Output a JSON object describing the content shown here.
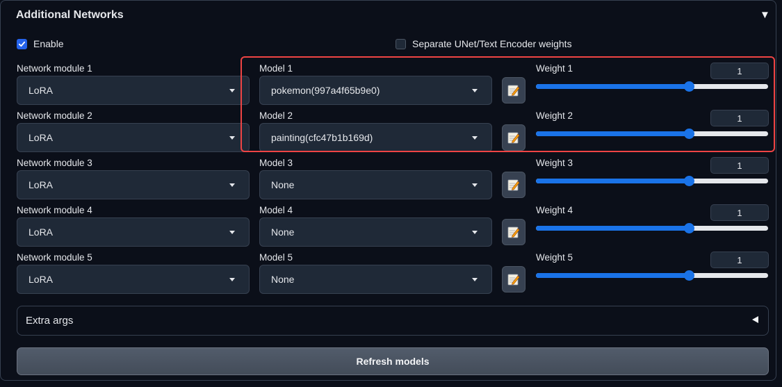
{
  "panel": {
    "title": "Additional Networks"
  },
  "enable": {
    "label": "Enable",
    "checked": true
  },
  "separate": {
    "label": "Separate UNet/Text Encoder weights",
    "checked": false
  },
  "rows": [
    {
      "module_label": "Network module 1",
      "module_value": "LoRA",
      "model_label": "Model 1",
      "model_value": "pokemon(997a4f65b9e0)",
      "weight_label": "Weight 1",
      "weight_value": "1",
      "weight_fraction": 0.66
    },
    {
      "module_label": "Network module 2",
      "module_value": "LoRA",
      "model_label": "Model 2",
      "model_value": "painting(cfc47b1b169d)",
      "weight_label": "Weight 2",
      "weight_value": "1",
      "weight_fraction": 0.66
    },
    {
      "module_label": "Network module 3",
      "module_value": "LoRA",
      "model_label": "Model 3",
      "model_value": "None",
      "weight_label": "Weight 3",
      "weight_value": "1",
      "weight_fraction": 0.66
    },
    {
      "module_label": "Network module 4",
      "module_value": "LoRA",
      "model_label": "Model 4",
      "model_value": "None",
      "weight_label": "Weight 4",
      "weight_value": "1",
      "weight_fraction": 0.66
    },
    {
      "module_label": "Network module 5",
      "module_value": "LoRA",
      "model_label": "Model 5",
      "model_value": "None",
      "weight_label": "Weight 5",
      "weight_value": "1",
      "weight_fraction": 0.66
    }
  ],
  "extra_args": {
    "label": "Extra args"
  },
  "refresh": {
    "label": "Refresh models"
  },
  "colors": {
    "accent": "#1a73e8",
    "highlight": "#ef4444",
    "checkbox": "#2563eb"
  }
}
